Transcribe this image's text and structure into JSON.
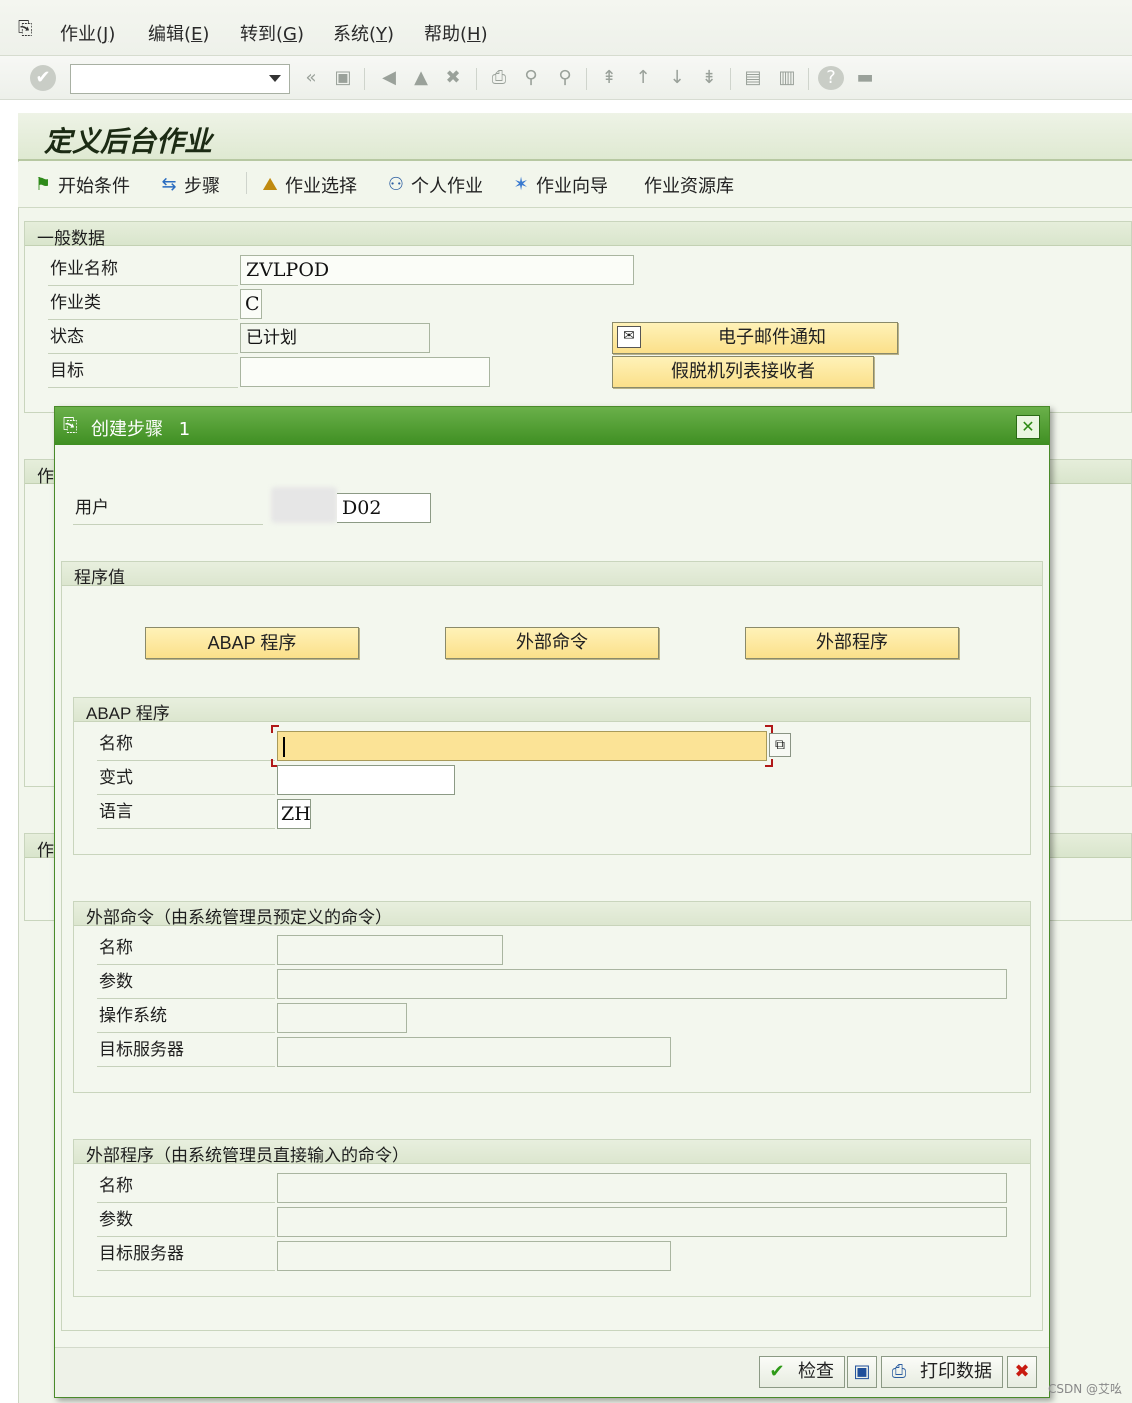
{
  "menu": {
    "items": [
      {
        "label": "作业(",
        "key": "J",
        "tail": ")"
      },
      {
        "label": "编辑(",
        "key": "E",
        "tail": ")"
      },
      {
        "label": "转到(",
        "key": "G",
        "tail": ")"
      },
      {
        "label": "系统(",
        "key": "Y",
        "tail": ")"
      },
      {
        "label": "帮助(",
        "key": "H",
        "tail": ")"
      }
    ]
  },
  "toolbar": {
    "command_value": "",
    "icons": [
      "enter-icon",
      "back-icon",
      "save-icon",
      "exit-icon",
      "cancel-icon",
      "print-icon",
      "find-icon",
      "find-next-icon",
      "first-page-icon",
      "previous-page-icon",
      "next-page-icon",
      "last-page-icon",
      "new-session-icon",
      "shortcut-icon",
      "help-icon",
      "layout-icon"
    ]
  },
  "page": {
    "title": "定义后台作业"
  },
  "appbar": {
    "start_condition": "开始条件",
    "steps": "步骤",
    "job_selection": "作业选择",
    "own_jobs": "个人作业",
    "job_wizard": "作业向导",
    "job_repository": "作业资源库"
  },
  "general": {
    "title": "一般数据",
    "job_name_label": "作业名称",
    "job_name_value": "ZVLPOD",
    "job_class_label": "作业类",
    "job_class_value": "C",
    "status_label": "状态",
    "status_value": "已计划",
    "target_label": "目标",
    "target_value": "",
    "email_btn": "电子邮件通知",
    "spool_btn": "假脱机列表接收者",
    "hidden_group_1": "作",
    "hidden_group_2": "作"
  },
  "dialog": {
    "title": "创建步骤",
    "step_no": "1",
    "user_label": "用户",
    "user_value": "D02",
    "program_values_title": "程序值",
    "abap_btn": "ABAP 程序",
    "ext_cmd_btn": "外部命令",
    "ext_prog_btn": "外部程序",
    "abap": {
      "title": "ABAP 程序",
      "name_label": "名称",
      "name_value": "",
      "variant_label": "变式",
      "variant_value": "",
      "language_label": "语言",
      "language_value": "ZH"
    },
    "ext_cmd": {
      "title": "外部命令（由系统管理员预定义的命令）",
      "name_label": "名称",
      "params_label": "参数",
      "os_label": "操作系统",
      "target_label": "目标服务器"
    },
    "ext_prog": {
      "title": "外部程序（由系统管理员直接输入的命令）",
      "name_label": "名称",
      "params_label": "参数",
      "target_label": "目标服务器"
    },
    "buttons": {
      "check": "检查",
      "print": "打印数据"
    }
  },
  "watermark": "CSDN @艾吆"
}
